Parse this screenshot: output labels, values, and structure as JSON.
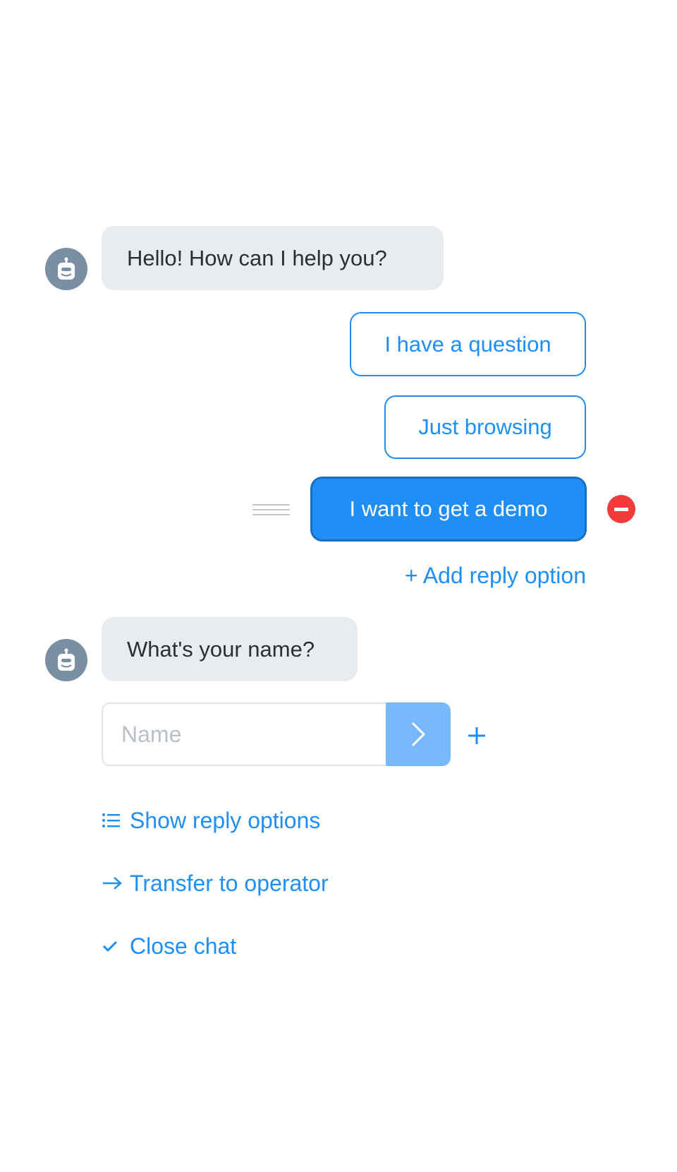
{
  "colors": {
    "accent": "#1f8ff5",
    "bot_bubble_bg": "#e9ecef",
    "avatar_bg": "#7a8fa3",
    "remove_red": "#f33b3b",
    "send_button_bg": "#78b9fb"
  },
  "messages": [
    {
      "sender": "bot",
      "avatar_icon": "robot-icon",
      "text": "Hello! How can I help you?"
    },
    {
      "sender": "bot",
      "avatar_icon": "robot-icon",
      "text": "What's your name?"
    }
  ],
  "reply_options": [
    {
      "label": "I have a question",
      "state": "default"
    },
    {
      "label": "Just browsing",
      "state": "default"
    },
    {
      "label": "I want to get a demo",
      "state": "selected"
    }
  ],
  "add_reply_option": {
    "icon": "plus-icon",
    "label": "+ Add reply option"
  },
  "name_input": {
    "placeholder": "Name",
    "value": ""
  },
  "actions": [
    {
      "icon": "list-icon",
      "label": "Show reply options"
    },
    {
      "icon": "arrow-right-icon",
      "label": "Transfer to operator"
    },
    {
      "icon": "check-icon",
      "label": "Close chat"
    }
  ]
}
